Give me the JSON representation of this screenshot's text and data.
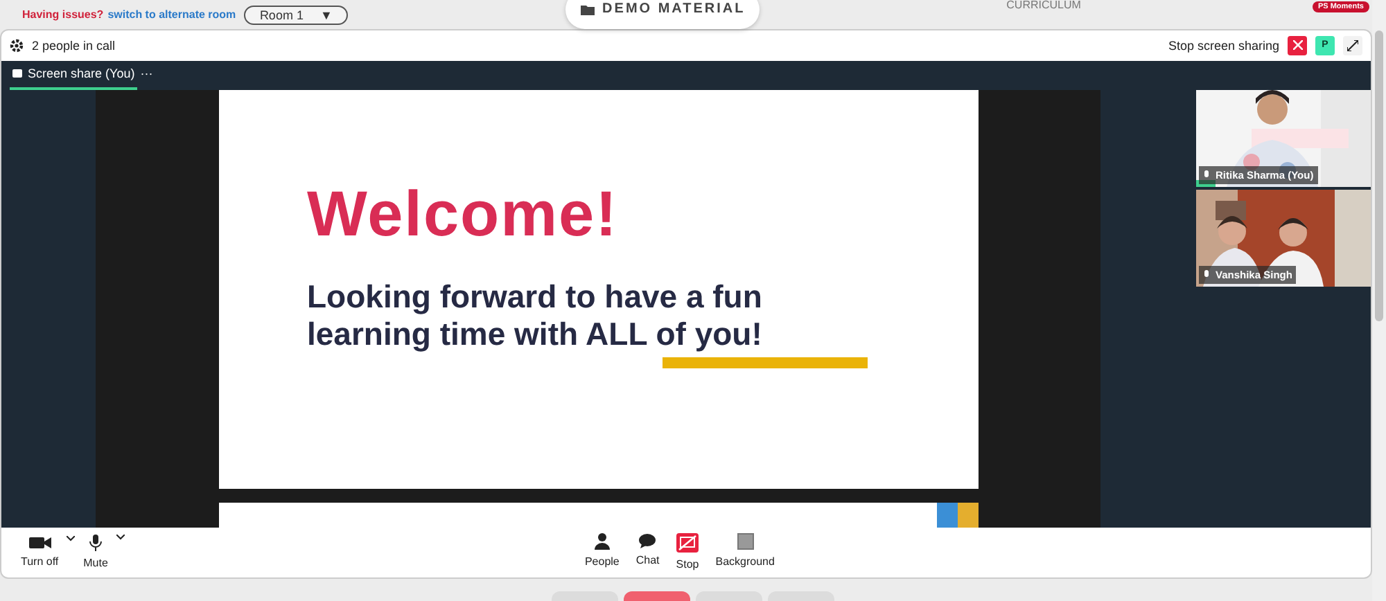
{
  "top_bar": {
    "issue_text": "Having issues?",
    "alternate_link": "switch to alternate room",
    "room_select": {
      "value": "Room 1",
      "caret": "▼"
    },
    "demo_button": "DEMO MATERIAL",
    "curriculum": "CURRICULUM",
    "moments_badge": "PS Moments"
  },
  "call_header": {
    "people_count": "2 people in call",
    "stop_sharing": "Stop screen sharing",
    "avatar_initial": "P"
  },
  "tabs": [
    {
      "label": "Screen share (You)",
      "selected": true
    }
  ],
  "tab_more": "···",
  "slide": {
    "title": "Welcome!",
    "body": "Looking forward to have a fun learning time with ALL of you!"
  },
  "participants": [
    {
      "name": "Ritika Sharma (You)",
      "speaking": true
    },
    {
      "name": "Vanshika Singh",
      "speaking": false
    }
  ],
  "controls": [
    {
      "label": "Turn off",
      "kind": "camera"
    },
    {
      "label": "Mute",
      "kind": "mic"
    }
  ],
  "actions": [
    {
      "label": "People",
      "kind": "people"
    },
    {
      "label": "Chat",
      "kind": "chat"
    },
    {
      "label": "Stop",
      "kind": "stop"
    },
    {
      "label": "Background",
      "kind": "background"
    }
  ]
}
